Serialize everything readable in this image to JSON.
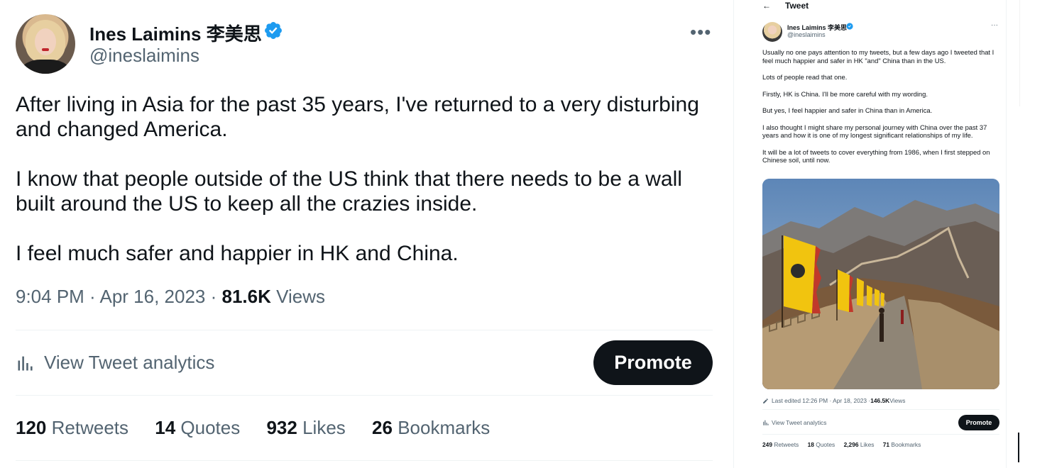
{
  "main": {
    "name": "Ines Laimins 李美思",
    "handle": "@ineslaimins",
    "more": "•••",
    "paragraphs": [
      "After living in Asia for the past 35 years, I've returned to a very disturbing and changed America.",
      "I know that people outside of the US think that there needs to be a wall built around the US to keep all the crazies inside.",
      "I feel much safer and happier in HK and China."
    ],
    "time": "9:04 PM · Apr 16, 2023 · ",
    "views_count": "81.6K",
    "views_label": " Views",
    "analytics_label": "View Tweet analytics",
    "promote_label": "Promote",
    "stats": [
      {
        "count": "120",
        "label": "Retweets"
      },
      {
        "count": "14",
        "label": "Quotes"
      },
      {
        "count": "932",
        "label": "Likes"
      },
      {
        "count": "26",
        "label": "Bookmarks"
      }
    ]
  },
  "side": {
    "back": "←",
    "title": "Tweet",
    "name": "Ines Laimins 李美思",
    "handle": "@ineslaimins",
    "more": "···",
    "paragraphs": [
      "Usually no one pays attention to my tweets, but a few days ago I tweeted that I feel much happier and safer in HK \"and\" China than in the US.",
      "Lots of people read that one.",
      "Firstly, HK is China.  I'll be more careful with my wording.",
      "But yes, I feel happier and safer in China than in America.",
      "I also thought I might share my personal journey with China over the past 37 years and how it is one of my longest significant relationships of my life.",
      "It will be a lot of tweets to cover everything from 1986, when I first stepped on Chinese soil, until now."
    ],
    "edited_prefix": "Last edited 12:26 PM · Apr 18, 2023 · ",
    "views_count": "146.5K",
    "views_label": " Views",
    "analytics_label": "View Tweet analytics",
    "promote_label": "Promote",
    "stats": [
      {
        "count": "249",
        "label": "Retweets"
      },
      {
        "count": "18",
        "label": "Quotes"
      },
      {
        "count": "2,296",
        "label": "Likes"
      },
      {
        "count": "71",
        "label": "Bookmarks"
      }
    ]
  },
  "colors": {
    "text": "#0f1419",
    "secondary": "#536471",
    "verified": "#1d9bf0",
    "button": "#0f1419",
    "divider": "#eff3f4"
  }
}
